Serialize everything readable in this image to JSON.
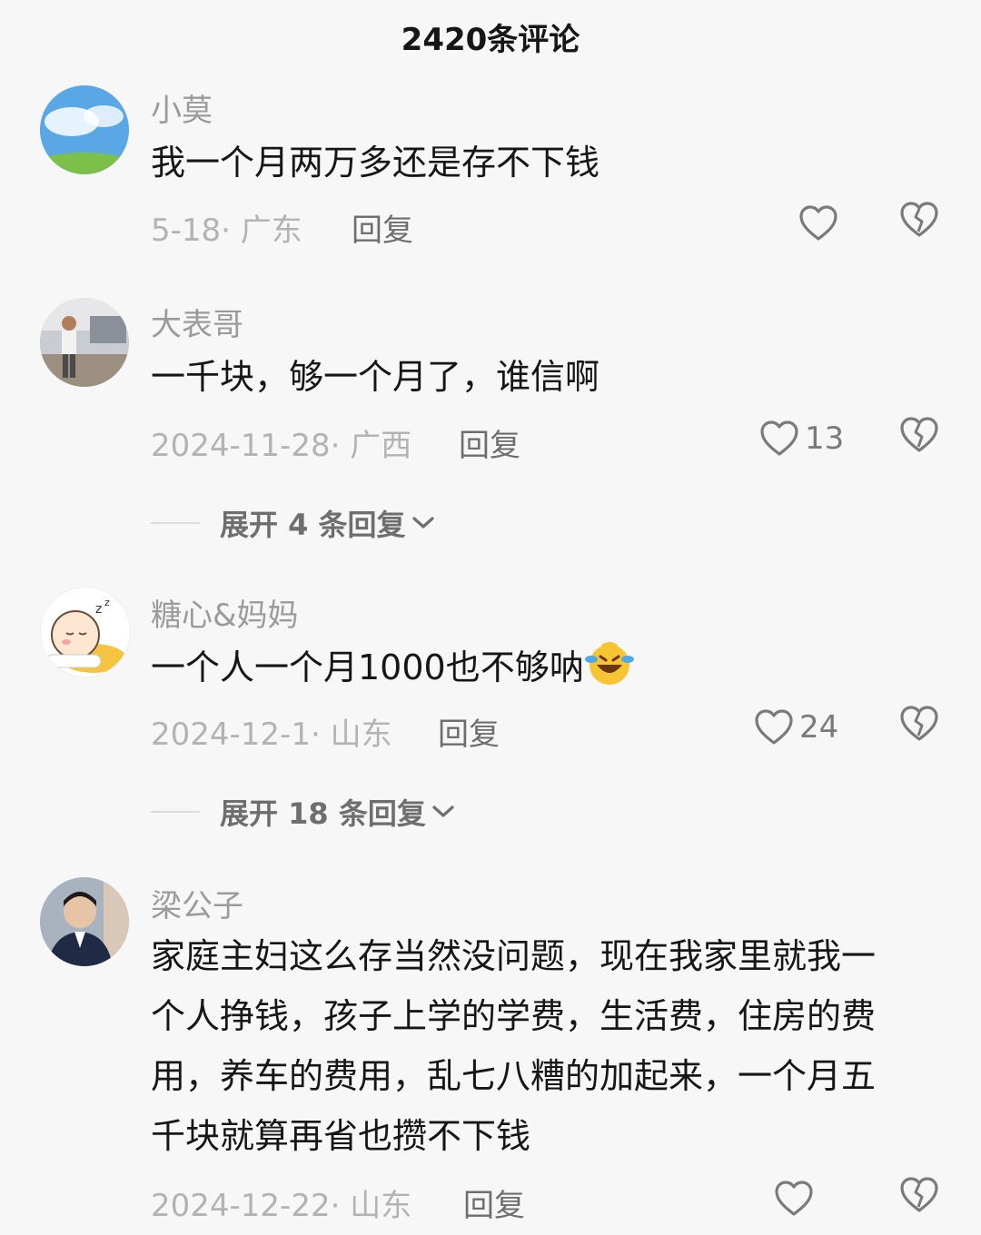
{
  "header": {
    "title": "2420条评论"
  },
  "comments": [
    {
      "name": "小莫",
      "text": "我一个月两万多还是存不下钱",
      "meta": "5-18· 广东",
      "reply_label": "回复",
      "likes": ""
    },
    {
      "name": "大表哥",
      "text": "一千块，够一个月了，谁信啊",
      "meta": "2024-11-28· 广西",
      "reply_label": "回复",
      "likes": "13",
      "expand_label": "展开 4 条回复"
    },
    {
      "name": "糖心&妈妈",
      "text": "一个人一个月1000也不够呐",
      "emoji": "rolling-laughing-emoji",
      "meta": "2024-12-1· 山东",
      "reply_label": "回复",
      "likes": "24",
      "expand_label": "展开 18 条回复"
    },
    {
      "name": "梁公子",
      "text": "家庭主妇这么存当然没问题，现在我家里就我一个人挣钱，孩子上学的学费，生活费，住房的费用，养车的费用，乱七八糟的加起来，一个月五千块就算再省也攒不下钱",
      "meta": "2024-12-22· 山东",
      "reply_label": "回复",
      "likes": ""
    }
  ],
  "icons": {
    "like": "heart-outline-icon",
    "dislike": "broken-heart-icon",
    "expand": "chevron-down-icon"
  }
}
